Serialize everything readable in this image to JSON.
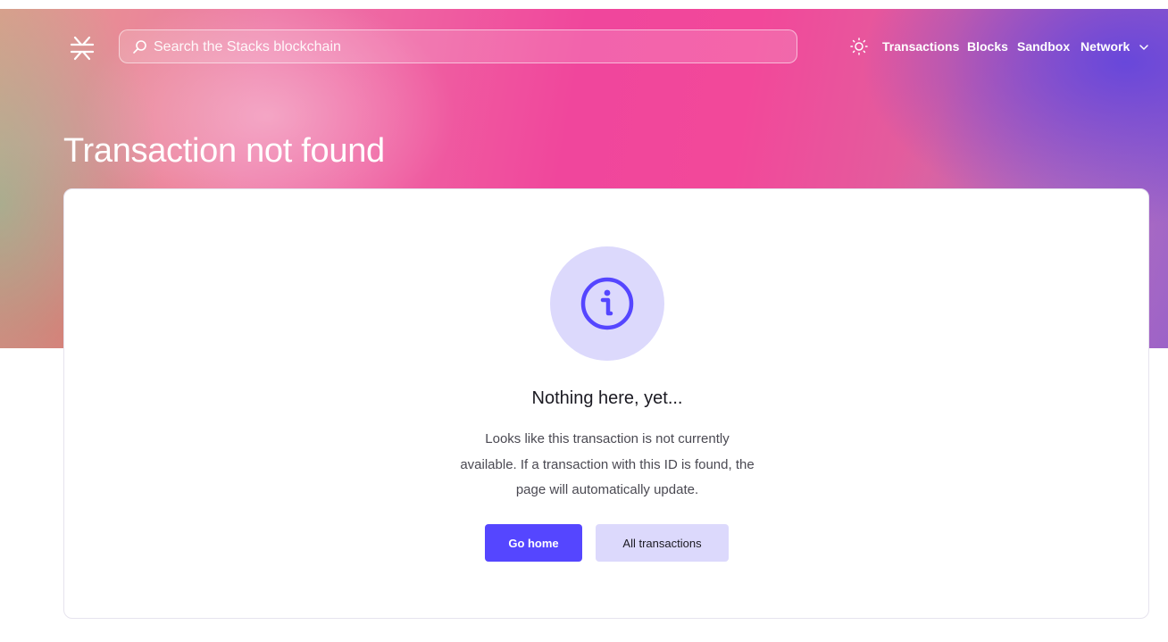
{
  "header": {
    "logo_icon": "stacks-logo-icon",
    "search_placeholder": "Search the Stacks blockchain",
    "theme_icon": "sun-icon",
    "nav": {
      "transactions": "Transactions",
      "blocks": "Blocks",
      "sandbox": "Sandbox",
      "network": "Network"
    },
    "network_icon": "chevron-down-icon"
  },
  "page": {
    "title": "Transaction not found"
  },
  "empty_state": {
    "icon": "info-icon",
    "heading": "Nothing here, yet...",
    "body": "Looks like this transaction is not currently available. If a transaction with this ID is found, the page will automatically update.",
    "buttons": {
      "home": "Go home",
      "all": "All transactions"
    }
  },
  "colors": {
    "accent": "#5546ff",
    "accent_soft": "#dcd9fc",
    "text_dark": "#1b1a22"
  }
}
